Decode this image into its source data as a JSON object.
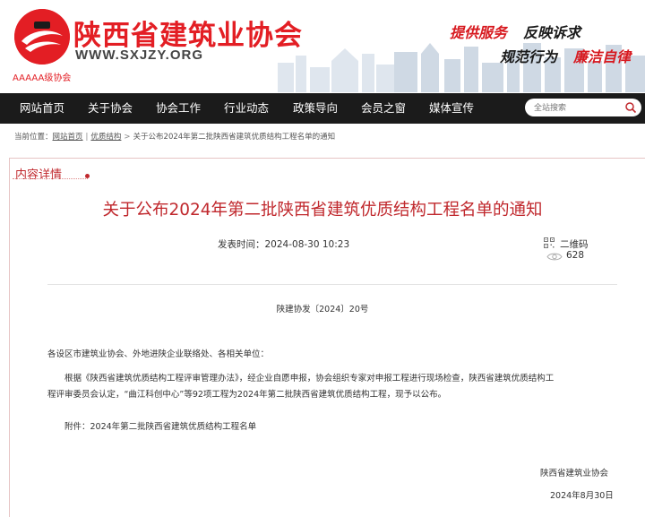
{
  "header": {
    "logo_title": "陕西省建筑业协会",
    "logo_url": "WWW.SXJZY.ORG",
    "rating": "AAAAA级协会",
    "slogans": [
      {
        "text": "提供服务",
        "color": "#d7191f"
      },
      {
        "text": "反映诉求",
        "color": "#1a1a1a"
      },
      {
        "text": "规范行为",
        "color": "#1a1a1a"
      },
      {
        "text": "廉洁自律",
        "color": "#d7191f"
      }
    ]
  },
  "nav": {
    "items": [
      "网站首页",
      "关于协会",
      "协会工作",
      "行业动态",
      "政策导向",
      "会员之窗",
      "媒体宣传"
    ],
    "search_placeholder": "全站搜索"
  },
  "breadcrumb": {
    "prefix": "当前位置：",
    "home": "网站首页",
    "category": "优质结构",
    "current": "关于公布2024年第二批陕西省建筑优质结构工程名单的通知"
  },
  "section": {
    "title": "内容详情"
  },
  "article": {
    "title": "关于公布2024年第二批陕西省建筑优质结构工程名单的通知",
    "publish_label": "发表时间：",
    "publish_time": "2024-08-30 10:23",
    "qr_label": "二维码",
    "views": "628",
    "doc_number": "陕建协发〔2024〕20号",
    "salutation": "各设区市建筑业协会、外地进陕企业联络处、各相关单位：",
    "paragraph_line1": "根据《陕西省建筑优质结构工程评审管理办法》，经企业自愿申报，协会组织专家对申报工程进行现场检查，陕西省建筑优质结构工",
    "paragraph_line2": "程评审委员会认定，“曲江科创中心”等92项工程为2024年第二批陕西省建筑优质结构工程，现予以公布。",
    "attachment": "附件：2024年第二批陕西省建筑优质结构工程名单",
    "signature_org": "陕西省建筑业协会",
    "signature_date": "2024年8月30日"
  },
  "colors": {
    "brand_red": "#e31e24",
    "title_red": "#c0282d",
    "nav_bg": "#1b1b1b"
  }
}
